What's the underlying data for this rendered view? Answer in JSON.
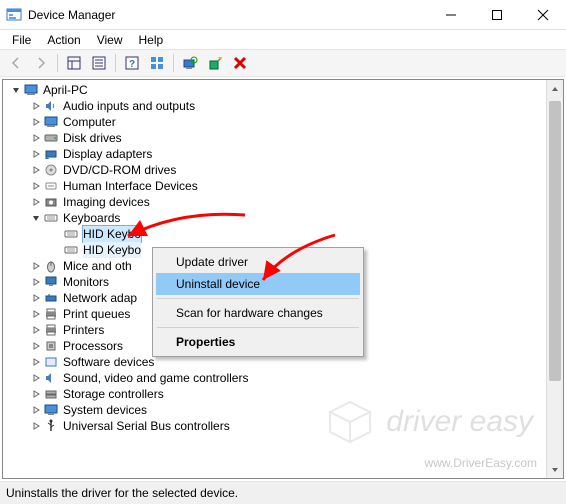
{
  "titlebar": {
    "title": "Device Manager"
  },
  "menu": {
    "file": "File",
    "action": "Action",
    "view": "View",
    "help": "Help"
  },
  "tree": {
    "root": "April-PC",
    "items": [
      "Audio inputs and outputs",
      "Computer",
      "Disk drives",
      "Display adapters",
      "DVD/CD-ROM drives",
      "Human Interface Devices",
      "Imaging devices",
      "Keyboards",
      "Mice and oth",
      "Monitors",
      "Network adap",
      "Print queues",
      "Printers",
      "Processors",
      "Software devices",
      "Sound, video and game controllers",
      "Storage controllers",
      "System devices",
      "Universal Serial Bus controllers"
    ],
    "kb_children": [
      "HID Keybo",
      "HID Keybo"
    ]
  },
  "context_menu": {
    "update": "Update driver",
    "uninstall": "Uninstall device",
    "scan": "Scan for hardware changes",
    "properties": "Properties"
  },
  "statusbar": {
    "text": "Uninstalls the driver for the selected device."
  },
  "watermark": {
    "brand": "driver easy",
    "url": "www.DriverEasy.com"
  }
}
